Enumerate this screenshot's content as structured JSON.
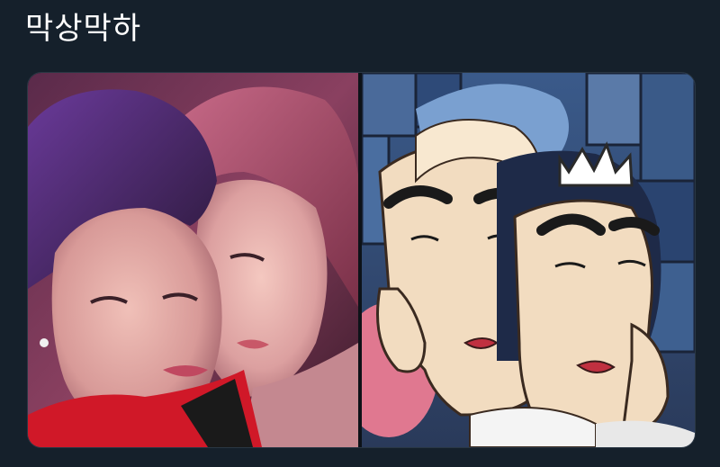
{
  "tweet": {
    "text": "막상막하"
  },
  "media": {
    "left_image": "photo-two-people-cheek-to-cheek",
    "right_image": "cartoon-two-characters-cheek-to-cheek"
  },
  "colors": {
    "background": "#15202b",
    "text": "#ffffff"
  }
}
